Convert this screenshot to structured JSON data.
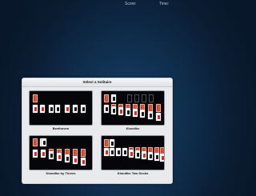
{
  "header": {
    "score_label": "Score:",
    "time_label": "Time:"
  },
  "dialog": {
    "title": "Select a Solitaire",
    "options": [
      {
        "id": "beethoven",
        "label": "Beethoven"
      },
      {
        "id": "klondike",
        "label": "Klondike"
      },
      {
        "id": "klondike-by-threes",
        "label": "Klondike by Threes"
      },
      {
        "id": "klondike-two-decks",
        "label": "Klondike Two Decks"
      }
    ]
  },
  "colors": {
    "background": "#0f2d4c",
    "dialog": "#e9eaec",
    "card_back": "#c8452b"
  },
  "icons": [
    "card-back-icon",
    "playing-card-icon"
  ]
}
